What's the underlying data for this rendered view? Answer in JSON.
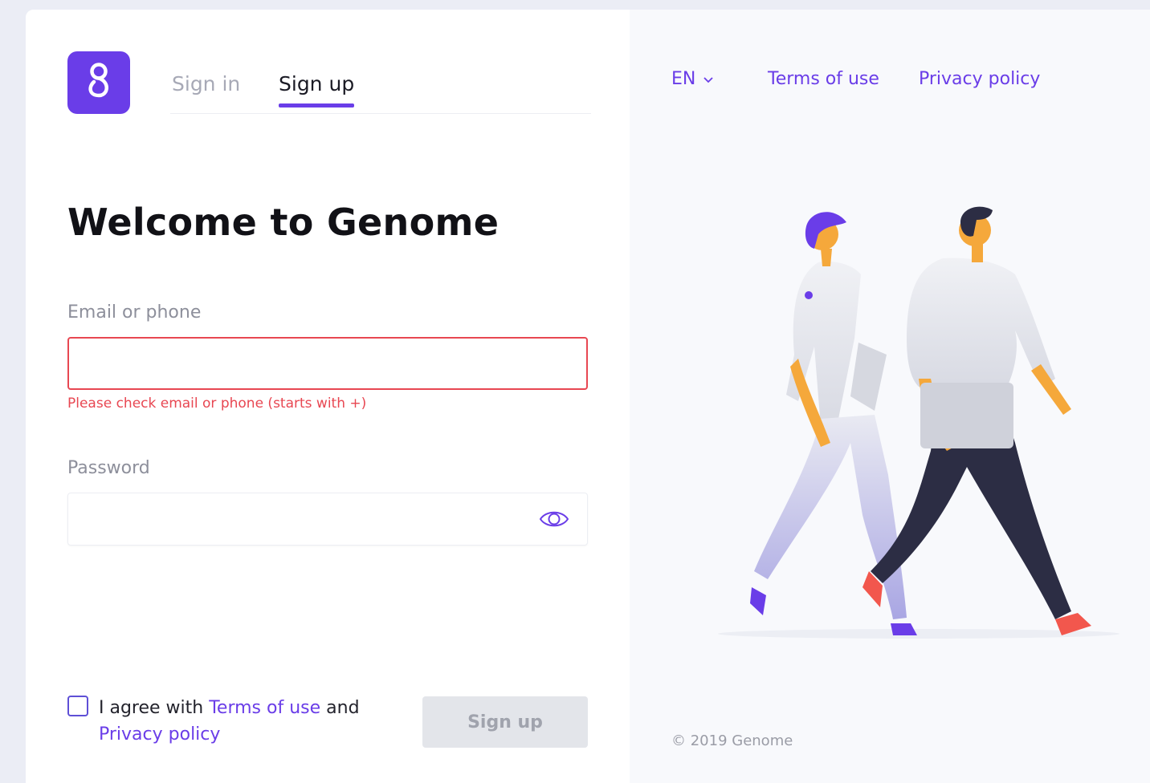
{
  "tabs": {
    "sign_in": "Sign in",
    "sign_up": "Sign up"
  },
  "welcome": "Welcome to Genome",
  "email": {
    "label": "Email or phone",
    "value": "",
    "error": "Please check email or phone (starts with +)"
  },
  "password": {
    "label": "Password",
    "value": ""
  },
  "agreement": {
    "prefix": "I agree with",
    "terms": "Terms of use",
    "conj": "and",
    "privacy": "Privacy policy"
  },
  "signup_button": "Sign up",
  "header": {
    "language": "EN",
    "terms": "Terms of use",
    "privacy": "Privacy policy"
  },
  "copyright": "© 2019 Genome",
  "colors": {
    "accent": "#6a3de8",
    "error": "#e84752",
    "disabled_button": "#e3e5ea"
  },
  "icons": {
    "logo": "genome-g-logo",
    "language": "chevron-down-icon",
    "password": "eye-icon"
  }
}
